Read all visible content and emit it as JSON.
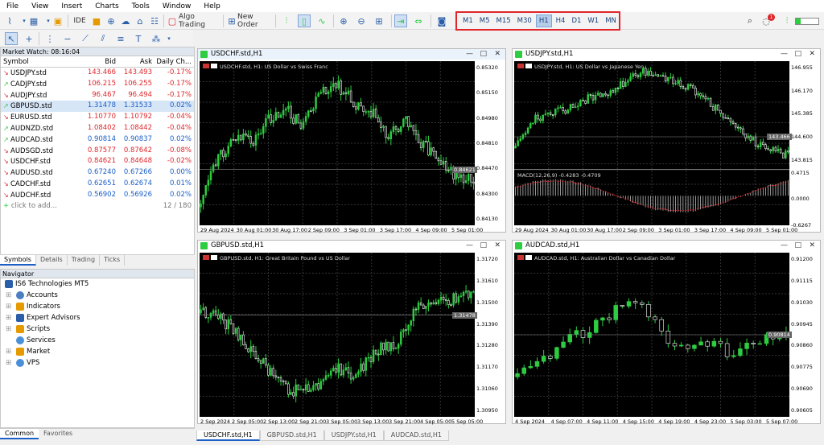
{
  "menu": [
    "File",
    "View",
    "Insert",
    "Charts",
    "Tools",
    "Window",
    "Help"
  ],
  "toolbar": {
    "ide": "IDE",
    "algo": "Algo Trading",
    "new_order": "New Order"
  },
  "timeframes": [
    "M1",
    "M5",
    "M15",
    "M30",
    "H1",
    "H4",
    "D1",
    "W1",
    "MN"
  ],
  "active_timeframe": "H1",
  "notif_count": "1",
  "market_watch": {
    "title": "Market Watch: 08:16:04",
    "headers": [
      "Symbol",
      "Bid",
      "Ask",
      "Daily Ch..."
    ],
    "rows": [
      {
        "sym": "USDJPY.std",
        "bid": "143.466",
        "ask": "143.493",
        "ch": "-0.17%",
        "dir": "dn"
      },
      {
        "sym": "CADJPY.std",
        "bid": "106.215",
        "ask": "106.255",
        "ch": "-0.17%",
        "dir": "up"
      },
      {
        "sym": "AUDJPY.std",
        "bid": "96.467",
        "ask": "96.494",
        "ch": "-0.17%",
        "dir": "dn"
      },
      {
        "sym": "GBPUSD.std",
        "bid": "1.31478",
        "ask": "1.31533",
        "ch": "0.02%",
        "dir": "up"
      },
      {
        "sym": "EURUSD.std",
        "bid": "1.10770",
        "ask": "1.10792",
        "ch": "-0.04%",
        "dir": "dn"
      },
      {
        "sym": "AUDNZD.std",
        "bid": "1.08402",
        "ask": "1.08442",
        "ch": "-0.04%",
        "dir": "up"
      },
      {
        "sym": "AUDCAD.std",
        "bid": "0.90814",
        "ask": "0.90837",
        "ch": "0.02%",
        "dir": "up"
      },
      {
        "sym": "AUDSGD.std",
        "bid": "0.87577",
        "ask": "0.87642",
        "ch": "-0.08%",
        "dir": "dn"
      },
      {
        "sym": "USDCHF.std",
        "bid": "0.84621",
        "ask": "0.84648",
        "ch": "-0.02%",
        "dir": "dn"
      },
      {
        "sym": "AUDUSD.std",
        "bid": "0.67240",
        "ask": "0.67266",
        "ch": "0.00%",
        "dir": "dn"
      },
      {
        "sym": "CADCHF.std",
        "bid": "0.62651",
        "ask": "0.62674",
        "ch": "0.01%",
        "dir": "dn"
      },
      {
        "sym": "AUDCHF.std",
        "bid": "0.56902",
        "ask": "0.56926",
        "ch": "0.02%",
        "dir": "dn"
      }
    ],
    "add": "click to add...",
    "count": "12 / 180"
  },
  "mw_tabs": [
    "Symbols",
    "Details",
    "Trading",
    "Ticks"
  ],
  "navigator": {
    "title": "Navigator",
    "root": "IS6 Technologies MT5",
    "items": [
      "Accounts",
      "Indicators",
      "Expert Advisors",
      "Scripts",
      "Services",
      "Market",
      "VPS"
    ]
  },
  "nav_tabs": [
    "Common",
    "Favorites"
  ],
  "charts": [
    {
      "title": "USDCHF.std,H1",
      "desc": "USDCHF.std, H1:  US Dollar vs Swiss Franc",
      "yticks": [
        "0.85320",
        "0.85150",
        "0.84980",
        "0.84810",
        "0.84470",
        "0.84300",
        "0.84130"
      ],
      "price": "0.84621",
      "xticks": [
        "29 Aug 2024",
        "30 Aug 01:00",
        "30 Aug 17:00",
        "2 Sep 09:00",
        "3 Sep 01:00",
        "3 Sep 17:00",
        "4 Sep 09:00",
        "5 Sep 01:00"
      ]
    },
    {
      "title": "USDJPY.std,H1",
      "desc": "USDJPY.std, H1:  US Dollar vs Japanese Yen",
      "yticks": [
        "146.955",
        "146.170",
        "145.385",
        "144.600",
        "143.815"
      ],
      "price": "143.466",
      "macd": "MACD(12,26,9) -0.4283 -0.4709",
      "myticks": [
        "0.4715",
        "0.0000",
        "-0.6267"
      ],
      "xticks": [
        "29 Aug 2024",
        "30 Aug 01:00",
        "30 Aug 17:00",
        "2 Sep 09:00",
        "3 Sep 01:00",
        "3 Sep 17:00",
        "4 Sep 09:00",
        "5 Sep 01:00"
      ]
    },
    {
      "title": "GBPUSD.std,H1",
      "desc": "GBPUSD.std, H1:  Great Britain Pound vs US Dollar",
      "yticks": [
        "1.31720",
        "1.31610",
        "1.31500",
        "1.31390",
        "1.31280",
        "1.31170",
        "1.31060",
        "1.30950"
      ],
      "price": "1.31478",
      "xticks": [
        "2 Sep 2024",
        "2 Sep 05:00",
        "2 Sep 13:00",
        "2 Sep 21:00",
        "3 Sep 05:00",
        "3 Sep 13:00",
        "3 Sep 21:00",
        "4 Sep 05:00",
        "5 Sep 05:00"
      ]
    },
    {
      "title": "AUDCAD.std,H1",
      "desc": "AUDCAD.std, H1:  Australian Dollar vs Canadian Dollar",
      "yticks": [
        "0.91200",
        "0.91115",
        "0.91030",
        "0.90945",
        "0.90860",
        "0.90775",
        "0.90690",
        "0.90605"
      ],
      "price": "0.90814",
      "xticks": [
        "4 Sep 2024",
        "4 Sep 07:00",
        "4 Sep 11:00",
        "4 Sep 15:00",
        "4 Sep 19:00",
        "4 Sep 23:00",
        "5 Sep 03:00",
        "5 Sep 07:00"
      ]
    }
  ],
  "bottom_tabs": [
    "USDCHF.std,H1",
    "GBPUSD.std,H1",
    "USDJPY.std,H1",
    "AUDCAD.std,H1"
  ],
  "colors": {
    "bull": "#2ecc40",
    "bear": "#ffffff",
    "wick": "#2ecc40",
    "accent": "#1b5fc7",
    "red": "#e0262b"
  }
}
